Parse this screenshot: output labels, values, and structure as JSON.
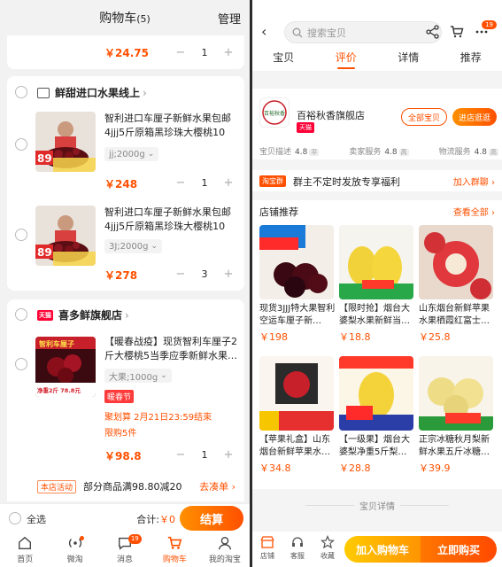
{
  "cart": {
    "title": "购物车",
    "count": "(5)",
    "manage": "管理",
    "top_item_price": "￥24.75",
    "top_item_qty": "1",
    "shops": [
      {
        "name": "鲜甜进口水果线上",
        "items": [
          {
            "title": "智利进口车厘子新鲜水果包邮4jjj5斤原箱黑珍珠大樱桃10斤…",
            "sku": "jj;2000g",
            "price": "￥248",
            "qty": "1",
            "thumb_label": "89"
          },
          {
            "title": "智利进口车厘子新鲜水果包邮4jjj5斤原箱黑珍珠大樱桃10斤…",
            "sku": "3J;2000g",
            "price": "￥278",
            "qty": "3",
            "thumb_label": "89"
          }
        ]
      },
      {
        "name": "喜多鲜旗舰店",
        "badge": "天猫",
        "items": [
          {
            "title": "【暖春战疫】现货智利车厘子2斤大樱桃5当季应季新鲜水果…",
            "sku": "大果;1000g",
            "tag": "暖春节",
            "promo1": "聚划算 2月21日23:59结束",
            "promo2": "限购5件",
            "price": "￥98.8",
            "qty": "1",
            "thumb_label": "智利车厘子",
            "thumb_price": "净重2斤 78.8元"
          }
        ],
        "promo_tag": "本店活动",
        "promo_text": "部分商品满98.80减20",
        "promo_link": "去凑单 ›"
      }
    ],
    "footer": {
      "select_all": "全选",
      "total_label": "合计:",
      "total_value": "￥0",
      "checkout": "结算"
    },
    "tabs": [
      {
        "label": "首页",
        "icon": "home-icon"
      },
      {
        "label": "微淘",
        "icon": "broadcast-icon"
      },
      {
        "label": "消息",
        "icon": "message-icon",
        "badge": "19"
      },
      {
        "label": "购物车",
        "icon": "cart-icon"
      },
      {
        "label": "我的淘宝",
        "icon": "user-icon"
      }
    ]
  },
  "product": {
    "search_placeholder": "搜索宝贝",
    "notif_badge": "19",
    "tabs": [
      "宝贝",
      "评价",
      "详情",
      "推荐"
    ],
    "active_tab": "评价",
    "store": {
      "logo_text": "百裕秋香",
      "name": "百裕秋香旗舰店",
      "badge": "天猫",
      "btn_all": "全部宝贝",
      "btn_visit": "进店逛逛",
      "metrics": [
        {
          "label": "宝贝描述",
          "value": "4.8",
          "level": "平"
        },
        {
          "label": "卖家服务",
          "value": "4.8",
          "level": "高"
        },
        {
          "label": "物流服务",
          "value": "4.8",
          "level": "高"
        }
      ]
    },
    "group": {
      "tag": "淘宝群",
      "text": "群主不定时发放专享福利",
      "link": "加入群聊 ›"
    },
    "recs": {
      "title": "店铺推荐",
      "all": "查看全部 ›",
      "items": [
        {
          "name": "现货3JJJ特大果智利空运车厘子新…",
          "price": "￥198"
        },
        {
          "name": "【限时抢】烟台大婆梨水果新鲜当…",
          "price": "￥18.8"
        },
        {
          "name": "山东烟台新鲜苹果水果栖霞红富士…",
          "price": "￥25.8"
        },
        {
          "name": "【苹果礼盒】山东烟台新鲜苹果水…",
          "price": "￥34.8"
        },
        {
          "name": "【一级果】烟台大婆梨净重5斤梨…",
          "price": "￥28.8"
        },
        {
          "name": "正宗冰糖秋月梨新鲜水果五斤冰糖…",
          "price": "￥39.9"
        }
      ]
    },
    "details_label": "宝贝详情",
    "bottom": {
      "shop": "店铺",
      "service": "客服",
      "favorite": "收藏",
      "add_cart": "加入购物车",
      "buy_now": "立即购买"
    }
  }
}
